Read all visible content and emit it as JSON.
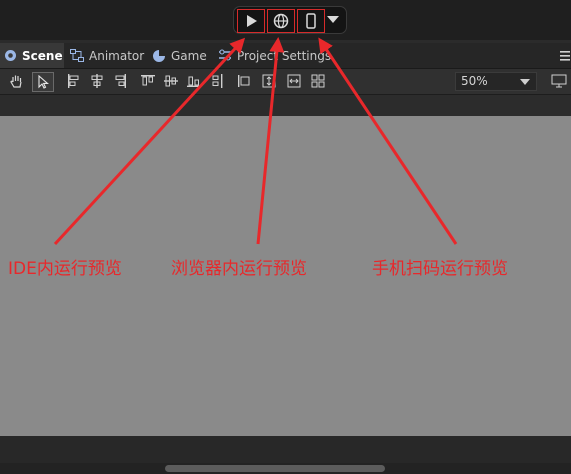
{
  "play_controls": {
    "play_title": "IDE内运行预览",
    "browser_title": "浏览器内运行预览",
    "mobile_title": "手机扫码运行预览"
  },
  "tabs": [
    {
      "label": "Scene",
      "icon": "scene-icon",
      "active": true
    },
    {
      "label": "Animator",
      "icon": "animator-icon",
      "active": false
    },
    {
      "label": "Game",
      "icon": "game-icon",
      "active": false
    },
    {
      "label": "Project Settings",
      "icon": "settings-icon",
      "active": false
    }
  ],
  "toolbar": {
    "zoom": "50%"
  },
  "annotations": {
    "ide_preview": "IDE内运行预览",
    "browser_preview": "浏览器内运行预览",
    "mobile_preview": "手机扫码运行预览"
  },
  "colors": {
    "annotation": "#e8282b",
    "viewport": "#8a8a8a",
    "panel": "#2b2b2b"
  }
}
